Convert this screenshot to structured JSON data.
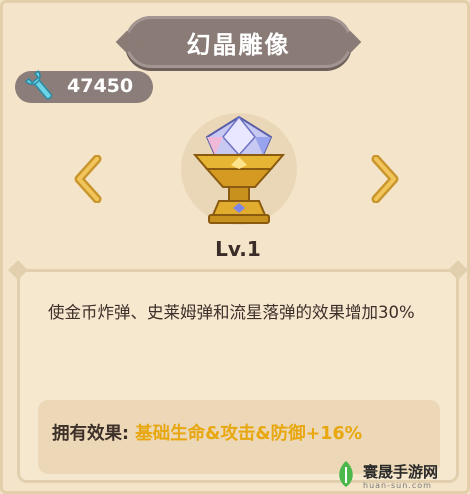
{
  "title": "幻晶雕像",
  "currency": {
    "icon": "wrench-icon",
    "value": "47450"
  },
  "navigation": {
    "prev_icon": "chevron-left-icon",
    "next_icon": "chevron-right-icon"
  },
  "statue": {
    "icon": "crystal-statue-icon",
    "level": "Lv.1"
  },
  "description": {
    "text": "使金币炸弹、史莱姆弹和流星落弹的效果增加30%",
    "effect_label": "拥有效果:",
    "effect_value": "基础生命&攻击&防御+16%"
  },
  "watermark": {
    "name": "寰晟手游网",
    "sub": "huan-sun.com"
  },
  "colors": {
    "accent": "#e8a70f",
    "banner": "#8a7b76",
    "text": "#3d2f29"
  }
}
